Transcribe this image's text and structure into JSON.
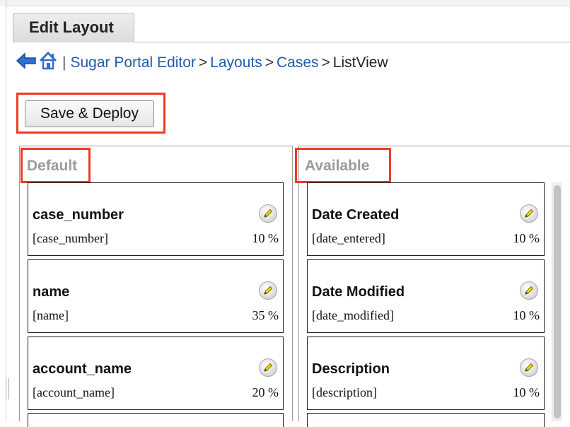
{
  "tab": {
    "label": "Edit Layout"
  },
  "breadcrumb": {
    "items": [
      "Sugar Portal Editor",
      "Layouts",
      "Cases",
      "ListView"
    ],
    "separator": ">",
    "pipe": "|"
  },
  "toolbar": {
    "save_label": "Save & Deploy"
  },
  "default_panel": {
    "title": "Default",
    "fields": [
      {
        "name": "case_number",
        "key": "[case_number]",
        "width": "10 %"
      },
      {
        "name": "name",
        "key": "[name]",
        "width": "35 %"
      },
      {
        "name": "account_name",
        "key": "[account_name]",
        "width": "20 %"
      }
    ]
  },
  "available_panel": {
    "title": "Available",
    "fields": [
      {
        "name": "Date Created",
        "key": "[date_entered]",
        "width": "10 %"
      },
      {
        "name": "Date Modified",
        "key": "[date_modified]",
        "width": "10 %"
      },
      {
        "name": "Description",
        "key": "[description]",
        "width": "10 %"
      }
    ]
  },
  "colors": {
    "highlight": "#ee3b23",
    "link": "#1f5ba8",
    "panel_title": "#9b9b9b",
    "back_arrow": "#2f6fd0"
  },
  "icons": [
    "back-arrow-icon",
    "home-icon",
    "pencil-icon"
  ]
}
